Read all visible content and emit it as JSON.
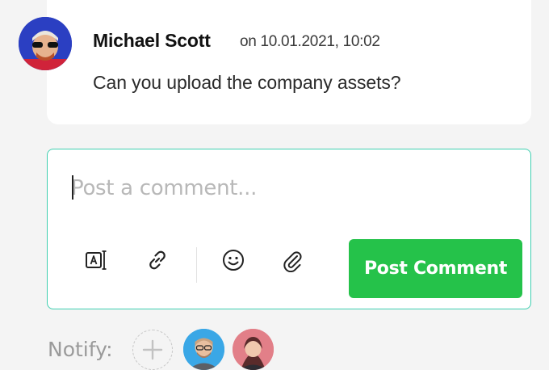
{
  "comment": {
    "author": "Michael Scott",
    "date": "on 10.01.2021, 10:02",
    "text": "Can you upload the company  assets?"
  },
  "composer": {
    "placeholder": "Post a comment...",
    "value": "",
    "tools": [
      {
        "icon": "text-format-icon"
      },
      {
        "icon": "link-icon"
      },
      {
        "icon": "emoji-icon"
      },
      {
        "icon": "paperclip-icon"
      }
    ],
    "post_label": "Post Comment"
  },
  "notify": {
    "label": "Notify:",
    "add_icon": "plus-icon",
    "users": [
      {
        "avatar": "avatar-male"
      },
      {
        "avatar": "avatar-female"
      }
    ]
  },
  "colors": {
    "accent": "#25c24a",
    "focus_border": "#3fcfb0",
    "background": "#f4f4f4"
  }
}
